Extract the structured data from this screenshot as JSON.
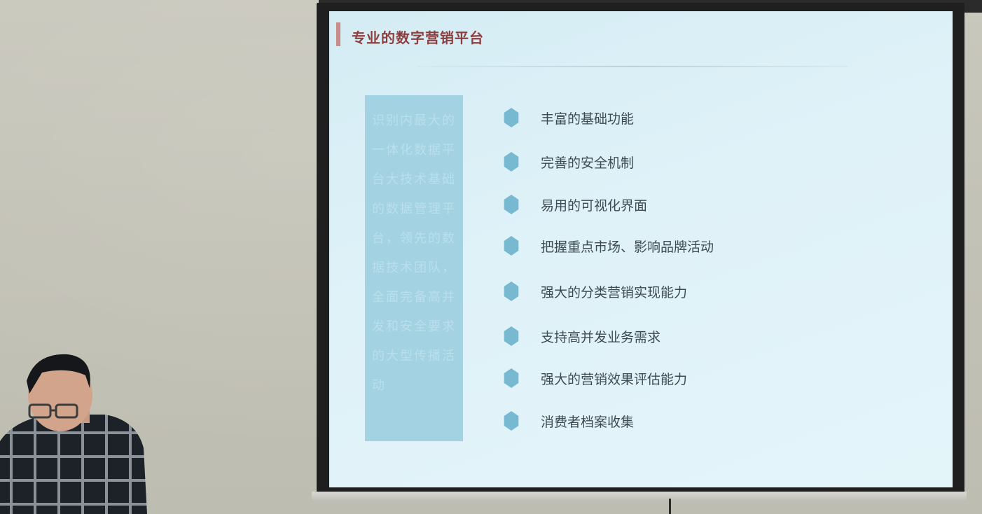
{
  "slide": {
    "title": "专业的数字营销平台",
    "side_panel_text": "识别内最大的一体化数据平台大技术基础的数据管理平台，领先的数据技术团队，全面完备高并发和安全要求的大型传播活动",
    "features": [
      "丰富的基础功能",
      "完善的安全机制",
      "易用的可视化界面",
      "把握重点市场、影响品牌活动",
      "强大的分类营销实现能力",
      "支持高并发业务需求",
      "强大的营销效果评估能力",
      "消费者档案收集"
    ]
  },
  "colors": {
    "slide_background": "#dff2f8",
    "title_color": "#8c3f3f",
    "accent_bar": "#c98a8a",
    "side_panel": "#a3d2e3",
    "bullet": "#78b9d2",
    "feature_text": "#3f4b52",
    "wall": "#c5c4b8",
    "screen_frame": "#1f1f1f"
  },
  "icons": {
    "bullet": "hexagon-bullet-icon"
  }
}
